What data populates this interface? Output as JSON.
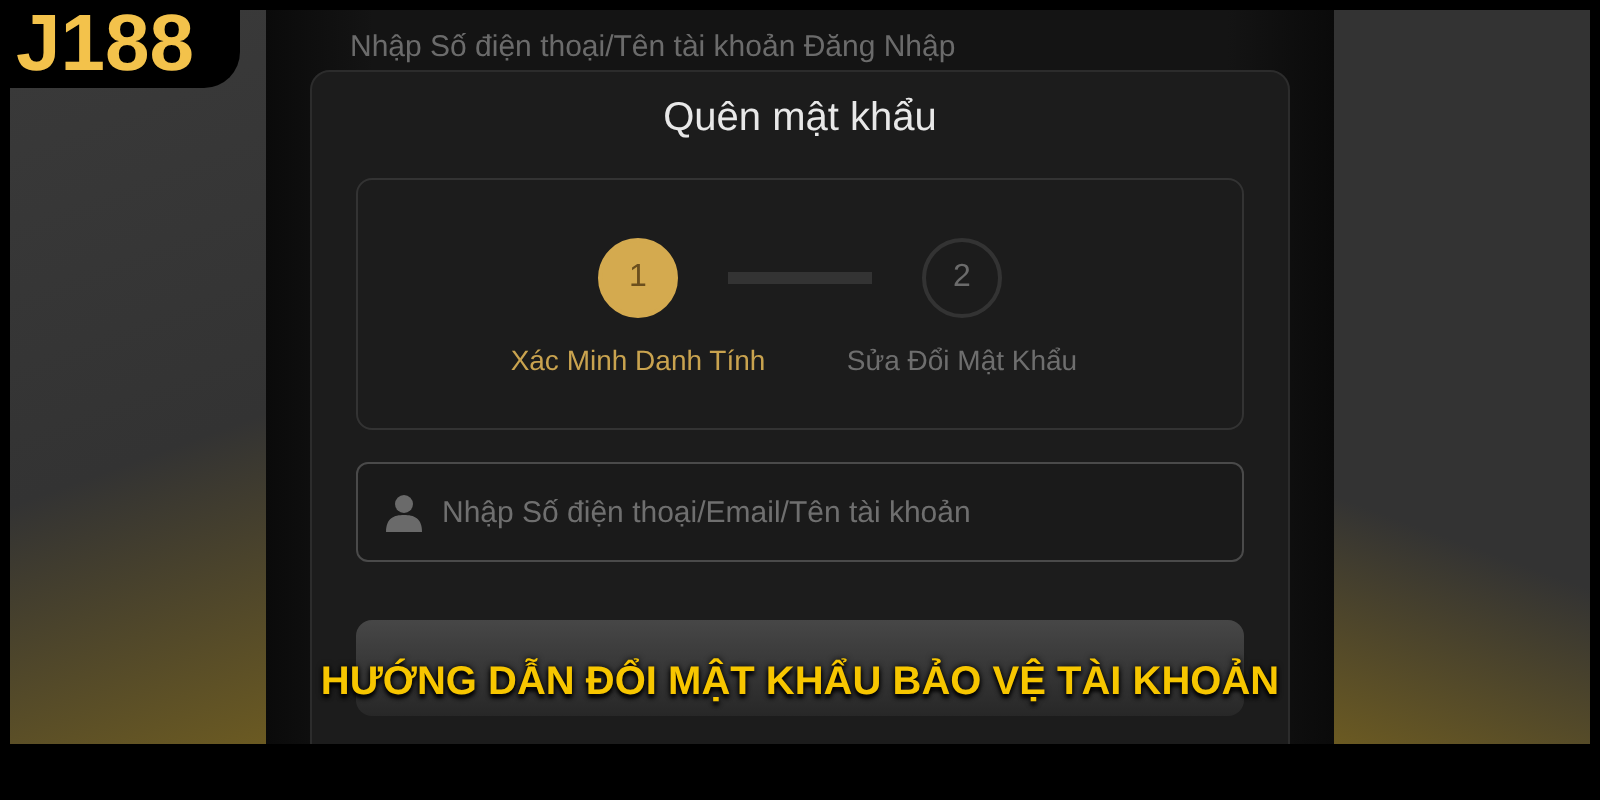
{
  "logo": {
    "text": "J188"
  },
  "background_page": {
    "hint": "Nhập Số điện thoại/Tên tài khoản Đăng Nhập"
  },
  "dialog": {
    "title": "Quên mật khẩu",
    "steps": [
      {
        "number": "1",
        "label": "Xác Minh Danh Tính",
        "selected": true
      },
      {
        "number": "2",
        "label": "Sửa Đổi Mật Khẩu",
        "selected": false
      }
    ],
    "field": {
      "placeholder": "Nhập Số điện thoại/Email/Tên tài khoản"
    },
    "button": {
      "disabled": true
    }
  },
  "caption": "HƯỚNG DẪN ĐỔI MẬT KHẨU BẢO VỆ TÀI KHOẢN"
}
